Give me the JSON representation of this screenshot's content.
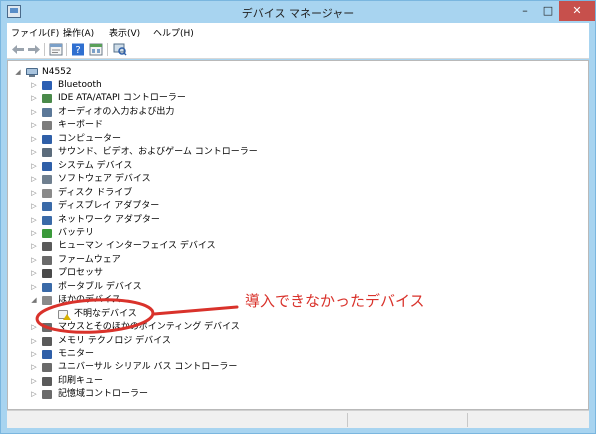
{
  "window": {
    "title": "デバイス マネージャー"
  },
  "menu": [
    "ファイル(F)",
    "操作(A)",
    "表示(V)",
    "ヘルプ(H)"
  ],
  "toolbar_icons": [
    "back-arrow-icon",
    "forward-arrow-icon",
    "properties-icon",
    "help-icon",
    "view-icon",
    "scan-hardware-icon"
  ],
  "tree": {
    "root": "N4552",
    "items": [
      {
        "label": "Bluetooth",
        "icon": "bluetooth-icon",
        "expander": "▷",
        "color": "#2c5fb3"
      },
      {
        "label": "IDE ATA/ATAPI コントローラー",
        "icon": "ide-controller-icon",
        "expander": "▷",
        "color": "#4a8a4a"
      },
      {
        "label": "オーディオの入力および出力",
        "icon": "audio-icon",
        "expander": "▷",
        "color": "#5b7898"
      },
      {
        "label": "キーボード",
        "icon": "keyboard-icon",
        "expander": "▷",
        "color": "#7d7d7d"
      },
      {
        "label": "コンピューター",
        "icon": "computer-icon",
        "expander": "▷",
        "color": "#2f5fa8"
      },
      {
        "label": "サウンド、ビデオ、およびゲーム コントローラー",
        "icon": "sound-video-icon",
        "expander": "▷",
        "color": "#5c6c7c"
      },
      {
        "label": "システム デバイス",
        "icon": "system-device-icon",
        "expander": "▷",
        "color": "#2f5fa8"
      },
      {
        "label": "ソフトウェア デバイス",
        "icon": "software-device-icon",
        "expander": "▷",
        "color": "#6f7f8f"
      },
      {
        "label": "ディスク ドライブ",
        "icon": "disk-drive-icon",
        "expander": "▷",
        "color": "#8a8a8a"
      },
      {
        "label": "ディスプレイ アダプター",
        "icon": "display-adapter-icon",
        "expander": "▷",
        "color": "#3a6aa8"
      },
      {
        "label": "ネットワーク アダプター",
        "icon": "network-adapter-icon",
        "expander": "▷",
        "color": "#3a6aa8"
      },
      {
        "label": "バッテリ",
        "icon": "battery-icon",
        "expander": "▷",
        "color": "#3a9a3a"
      },
      {
        "label": "ヒューマン インターフェイス デバイス",
        "icon": "hid-icon",
        "expander": "▷",
        "color": "#5a5a5a"
      },
      {
        "label": "ファームウェア",
        "icon": "firmware-icon",
        "expander": "▷",
        "color": "#6a6a6a"
      },
      {
        "label": "プロセッサ",
        "icon": "processor-icon",
        "expander": "▷",
        "color": "#4a4a4a"
      },
      {
        "label": "ポータブル デバイス",
        "icon": "portable-device-icon",
        "expander": "▷",
        "color": "#3a6aa8"
      },
      {
        "label": "ほかのデバイス",
        "icon": "other-devices-icon",
        "expander": "◢",
        "color": "#8a8a8a"
      },
      {
        "label": "不明なデバイス",
        "icon": "unknown-device-warning-icon",
        "expander": "",
        "color": "#d8b000",
        "child": true
      },
      {
        "label": "マウスとそのほかのポインティング デバイス",
        "icon": "mouse-icon",
        "expander": "▷",
        "color": "#6a6a6a"
      },
      {
        "label": "メモリ テクノロジ デバイス",
        "icon": "memory-device-icon",
        "expander": "▷",
        "color": "#5a5a5a"
      },
      {
        "label": "モニター",
        "icon": "monitor-icon",
        "expander": "▷",
        "color": "#2f5fa8"
      },
      {
        "label": "ユニバーサル シリアル バス コントローラー",
        "icon": "usb-icon",
        "expander": "▷",
        "color": "#6a6a6a"
      },
      {
        "label": "印刷キュー",
        "icon": "print-queue-icon",
        "expander": "▷",
        "color": "#5a5a5a"
      },
      {
        "label": "記憶域コントローラー",
        "icon": "storage-controller-icon",
        "expander": "▷",
        "color": "#6a6a6a"
      }
    ]
  },
  "annotation": {
    "text": "導入できなかったデバイス",
    "color": "#d9322b"
  }
}
